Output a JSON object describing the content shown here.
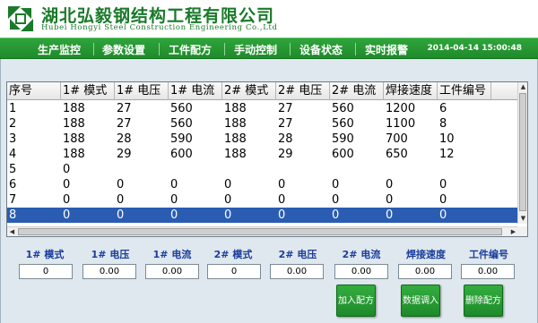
{
  "header": {
    "company_cn": "湖北弘毅钢结构工程有限公司",
    "company_en": "Hubei Hongyi Steel Construction Engineering Co.,Ltd"
  },
  "nav": {
    "items": [
      "生产监控",
      "参数设置",
      "工件配方",
      "手动控制",
      "设备状态",
      "实时报警"
    ],
    "datetime": "2014-04-14 15:00:48"
  },
  "grid": {
    "columns": [
      "序号",
      "1# 模式",
      "1# 电压",
      "1# 电流",
      "2# 模式",
      "2# 电压",
      "2# 电流",
      "焊接速度",
      "工件编号"
    ],
    "rows": [
      [
        "1",
        "188",
        "27",
        "560",
        "188",
        "27",
        "560",
        "1200",
        "6"
      ],
      [
        "2",
        "188",
        "27",
        "560",
        "188",
        "27",
        "560",
        "1100",
        "8"
      ],
      [
        "3",
        "188",
        "28",
        "590",
        "188",
        "28",
        "590",
        "700",
        "10"
      ],
      [
        "4",
        "188",
        "29",
        "600",
        "188",
        "29",
        "600",
        "650",
        "12"
      ],
      [
        "5",
        "0",
        "",
        "",
        "",
        "",
        "",
        "",
        ""
      ],
      [
        "6",
        "0",
        "0",
        "0",
        "0",
        "0",
        "0",
        "0",
        "0"
      ],
      [
        "7",
        "0",
        "0",
        "0",
        "0",
        "0",
        "0",
        "0",
        "0"
      ],
      [
        "8",
        "0",
        "0",
        "0",
        "0",
        "0",
        "0",
        "0",
        "0"
      ]
    ],
    "selected_row": "8"
  },
  "params": [
    {
      "label": "1# 模式",
      "value": "0"
    },
    {
      "label": "1# 电压",
      "value": "0.00"
    },
    {
      "label": "1# 电流",
      "value": "0.00"
    },
    {
      "label": "2# 模式",
      "value": "0"
    },
    {
      "label": "2# 电压",
      "value": "0.00"
    },
    {
      "label": "2# 电流",
      "value": "0.00"
    },
    {
      "label": "焊接速度",
      "value": "0.00"
    },
    {
      "label": "工件编号",
      "value": "0.00"
    }
  ],
  "buttons": {
    "add_recipe": "加入配方",
    "load_data": "数据调入",
    "delete_recipe": "删除配方"
  },
  "colors": {
    "brand_green": "#1a7a2a",
    "nav_green": "#2fa43c",
    "selected_row": "#2a5db2",
    "param_label": "#1b3d9e"
  }
}
